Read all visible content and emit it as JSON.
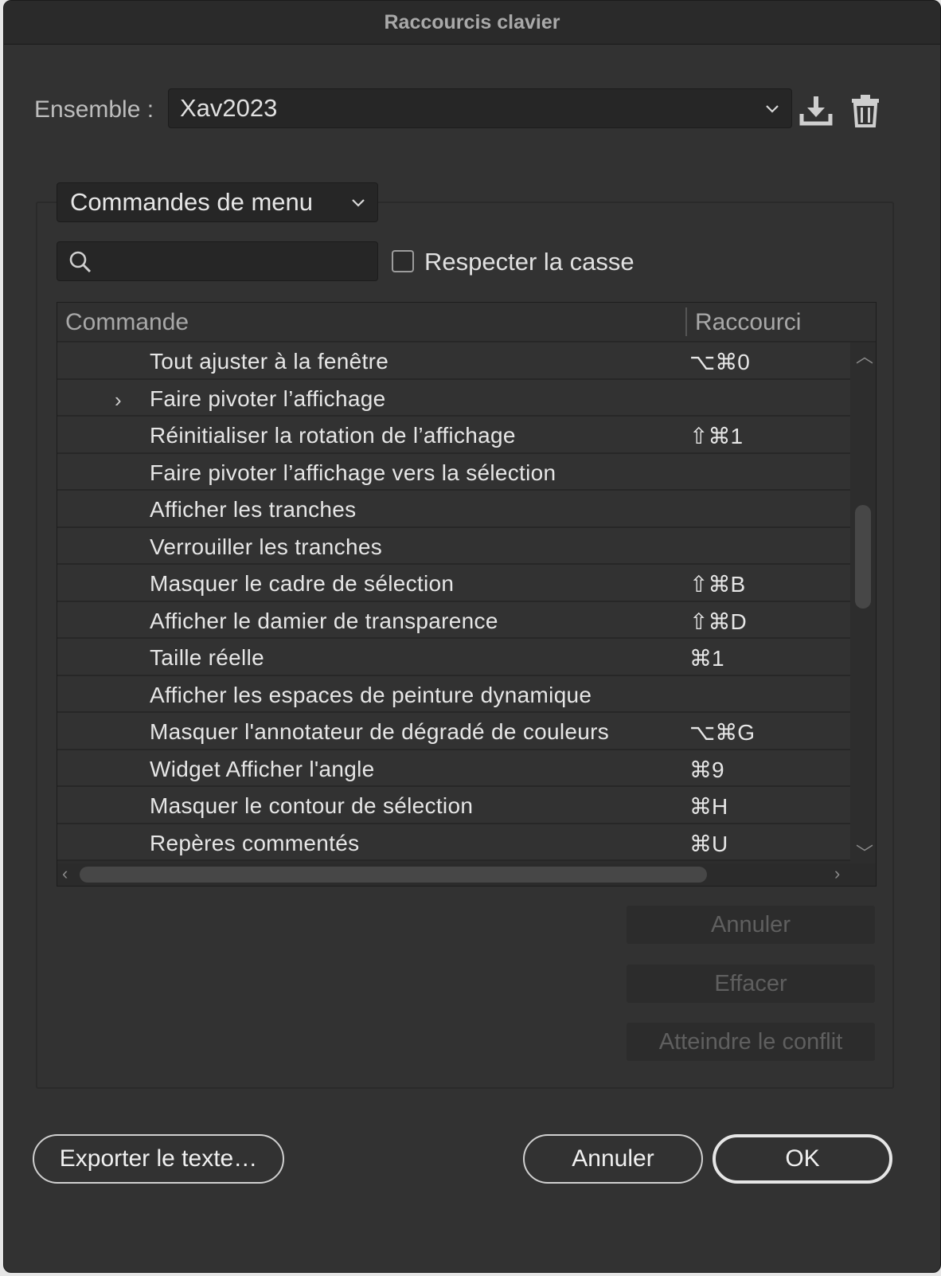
{
  "window": {
    "title": "Raccourcis clavier"
  },
  "set": {
    "label": "Ensemble :",
    "value": "Xav2023"
  },
  "icons": {
    "save": "download-icon",
    "delete": "trash-icon",
    "search": "search-icon"
  },
  "filter": {
    "menu_value": "Commandes de menu",
    "search_value": "",
    "match_case_label": "Respecter la casse",
    "match_case_checked": false
  },
  "table": {
    "columns": [
      "Commande",
      "Raccourci"
    ],
    "rows": [
      {
        "command": "Tout ajuster à la fenêtre",
        "shortcut": "⌥⌘0",
        "expander": ""
      },
      {
        "command": "Faire pivoter l’affichage",
        "shortcut": "",
        "expander": "›"
      },
      {
        "command": "Réinitialiser la rotation de l’affichage",
        "shortcut": "⇧⌘1",
        "expander": ""
      },
      {
        "command": "Faire pivoter l’affichage vers la sélection",
        "shortcut": "",
        "expander": ""
      },
      {
        "command": "Afficher les tranches",
        "shortcut": "",
        "expander": ""
      },
      {
        "command": "Verrouiller les tranches",
        "shortcut": "",
        "expander": ""
      },
      {
        "command": "Masquer le cadre de sélection",
        "shortcut": "⇧⌘B",
        "expander": ""
      },
      {
        "command": "Afficher le damier de transparence",
        "shortcut": "⇧⌘D",
        "expander": ""
      },
      {
        "command": "Taille réelle",
        "shortcut": "⌘1",
        "expander": ""
      },
      {
        "command": "Afficher les espaces de peinture dynamique",
        "shortcut": "",
        "expander": ""
      },
      {
        "command": "Masquer l'annotateur de dégradé de couleurs",
        "shortcut": "⌥⌘G",
        "expander": ""
      },
      {
        "command": "Widget Afficher l'angle",
        "shortcut": "⌘9",
        "expander": ""
      },
      {
        "command": "Masquer le contour de sélection",
        "shortcut": "⌘H",
        "expander": ""
      },
      {
        "command": "Repères commentés",
        "shortcut": "⌘U",
        "expander": ""
      }
    ]
  },
  "side_buttons": {
    "undo": "Annuler",
    "clear": "Effacer",
    "goto_conflict": "Atteindre le conflit"
  },
  "footer": {
    "export": "Exporter le texte…",
    "cancel": "Annuler",
    "ok": "OK"
  }
}
